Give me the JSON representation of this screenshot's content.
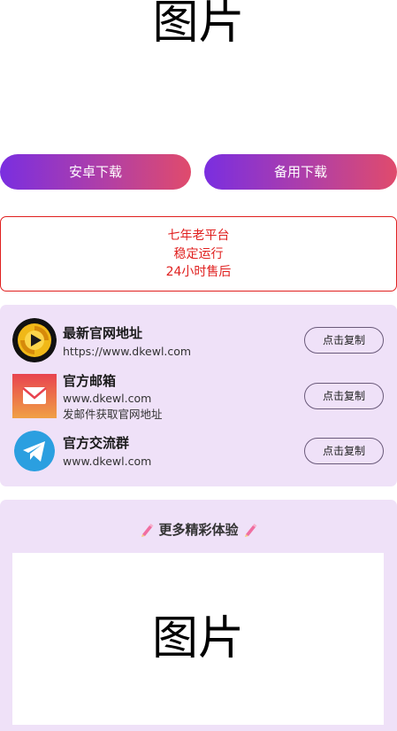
{
  "hero": {
    "image_label": "图片"
  },
  "downloads": {
    "android_label": "安卓下载",
    "backup_label": "备用下载"
  },
  "notice": {
    "line1": "七年老平台",
    "line2": "稳定运行",
    "line3": "24小时售后"
  },
  "contacts": [
    {
      "title": "最新官网地址",
      "sub1": "https://www.dkewl.com",
      "sub2": "",
      "button": "点击复制",
      "icon": "play-logo-icon"
    },
    {
      "title": "官方邮箱",
      "sub1": "www.dkewl.com",
      "sub2": "发邮件获取官网地址",
      "button": "点击复制",
      "icon": "mail-icon"
    },
    {
      "title": "官方交流群",
      "sub1": "www.dkewl.com",
      "sub2": "",
      "button": "点击复制",
      "icon": "telegram-icon"
    }
  ],
  "more": {
    "heading": "更多精彩体验",
    "image_label": "图片"
  },
  "colors": {
    "gradient_start": "#7a2ee0",
    "gradient_end": "#e04b6c",
    "notice_red": "#e0201f",
    "card_bg": "#efe1f8"
  }
}
